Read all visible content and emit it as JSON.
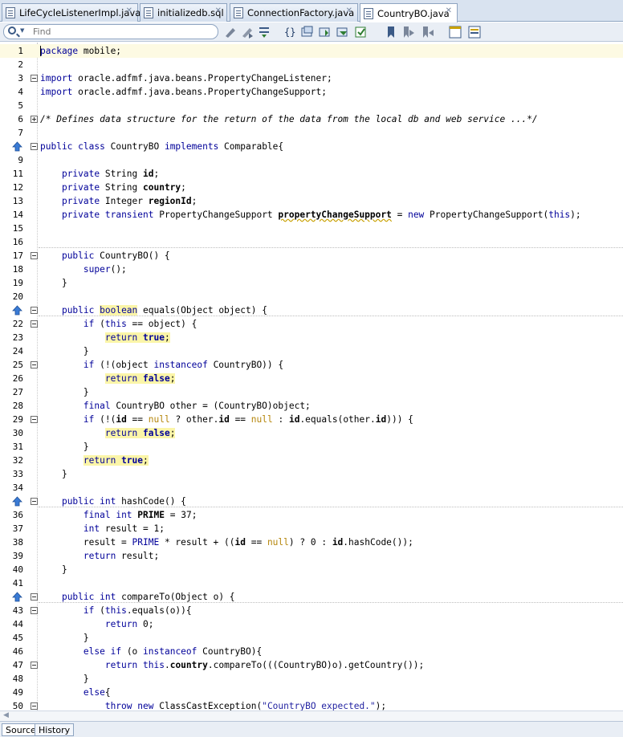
{
  "tabs": [
    {
      "label": "LifeCycleListenerImpl.java",
      "active": false
    },
    {
      "label": "initializedb.sql",
      "active": false
    },
    {
      "label": "ConnectionFactory.java",
      "active": false
    },
    {
      "label": "CountryBO.java",
      "active": true
    }
  ],
  "toolbar": {
    "search_placeholder": "Find",
    "buttons": [
      "back-history-icon",
      "forward-history-icon",
      "last-edit-icon",
      "toggle-bookmark-icon",
      "find-selection-icon",
      "find-previous-icon",
      "find-next-icon",
      "highlight-icon",
      "bookmark-icon",
      "previous-bookmark-icon",
      "next-bookmark-icon",
      "start-macro-icon",
      "stop-macro-icon"
    ]
  },
  "editor": {
    "current_line": 1,
    "lines": [
      {
        "n": "1",
        "text": "package mobile;"
      },
      {
        "n": "2",
        "text": ""
      },
      {
        "n": "3",
        "text": "import oracle.adfmf.java.beans.PropertyChangeListener;"
      },
      {
        "n": "4",
        "text": "import oracle.adfmf.java.beans.PropertyChangeSupport;"
      },
      {
        "n": "5",
        "text": ""
      },
      {
        "n": "6",
        "text": "/* Defines data structure for the return of the data from the local db and web service ...*/"
      },
      {
        "n": "7",
        "text": ""
      },
      {
        "n": "",
        "text": "public class CountryBO implements Comparable{"
      },
      {
        "n": "9",
        "text": ""
      },
      {
        "n": "11",
        "text": "    private String id;"
      },
      {
        "n": "12",
        "text": "    private String country;"
      },
      {
        "n": "13",
        "text": "    private Integer regionId;"
      },
      {
        "n": "14",
        "text": "    private transient PropertyChangeSupport propertyChangeSupport = new PropertyChangeSupport(this);"
      },
      {
        "n": "15",
        "text": ""
      },
      {
        "n": "16",
        "text": ""
      },
      {
        "n": "17",
        "text": "    public CountryBO() {"
      },
      {
        "n": "18",
        "text": "        super();"
      },
      {
        "n": "19",
        "text": "    }"
      },
      {
        "n": "20",
        "text": ""
      },
      {
        "n": "",
        "text": "    public boolean equals(Object object) {"
      },
      {
        "n": "22",
        "text": "        if (this == object) {"
      },
      {
        "n": "23",
        "text": "            return true;"
      },
      {
        "n": "24",
        "text": "        }"
      },
      {
        "n": "25",
        "text": "        if (!(object instanceof CountryBO)) {"
      },
      {
        "n": "26",
        "text": "            return false;"
      },
      {
        "n": "27",
        "text": "        }"
      },
      {
        "n": "28",
        "text": "        final CountryBO other = (CountryBO)object;"
      },
      {
        "n": "29",
        "text": "        if (!(id == null ? other.id == null : id.equals(other.id))) {"
      },
      {
        "n": "30",
        "text": "            return false;"
      },
      {
        "n": "31",
        "text": "        }"
      },
      {
        "n": "32",
        "text": "        return true;"
      },
      {
        "n": "33",
        "text": "    }"
      },
      {
        "n": "34",
        "text": ""
      },
      {
        "n": "",
        "text": "    public int hashCode() {"
      },
      {
        "n": "36",
        "text": "        final int PRIME = 37;"
      },
      {
        "n": "37",
        "text": "        int result = 1;"
      },
      {
        "n": "38",
        "text": "        result = PRIME * result + ((id == null) ? 0 : id.hashCode());"
      },
      {
        "n": "39",
        "text": "        return result;"
      },
      {
        "n": "40",
        "text": "    }"
      },
      {
        "n": "41",
        "text": ""
      },
      {
        "n": "",
        "text": "    public int compareTo(Object o) {"
      },
      {
        "n": "43",
        "text": "        if (this.equals(o)){"
      },
      {
        "n": "44",
        "text": "            return 0;"
      },
      {
        "n": "45",
        "text": "        }"
      },
      {
        "n": "46",
        "text": "        else if (o instanceof CountryBO){"
      },
      {
        "n": "47",
        "text": "            return this.country.compareTo(((CountryBO)o).getCountry());"
      },
      {
        "n": "48",
        "text": "        }"
      },
      {
        "n": "49",
        "text": "        else{"
      },
      {
        "n": "50",
        "text": "            throw new ClassCastException(\"CountryBO expected.\");"
      }
    ]
  },
  "bottom_tabs": [
    {
      "label": "Source",
      "active": true
    },
    {
      "label": "History",
      "active": false
    }
  ]
}
